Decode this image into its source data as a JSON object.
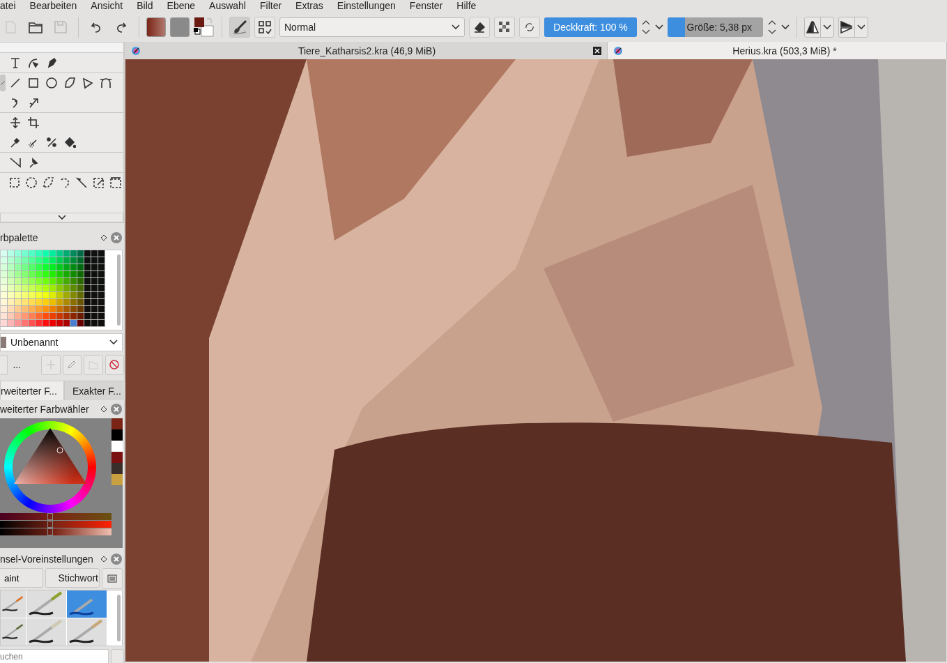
{
  "menu": [
    "atei",
    "Bearbeiten",
    "Ansicht",
    "Bild",
    "Ebene",
    "Auswahl",
    "Filter",
    "Extras",
    "Einstellungen",
    "Fenster",
    "Hilfe"
  ],
  "toolbar": {
    "blend_mode": "Normal",
    "opacity": {
      "label": "Deckkraft: 100 %",
      "level": 1
    },
    "size": {
      "label": "Größe: 5,38 px",
      "level": 0.18
    }
  },
  "documents": [
    {
      "title": "Tiere_Katharsis2.kra (46,9 MiB)",
      "selected": false
    },
    {
      "title": "Herius.kra (503,3 MiB) *",
      "selected": true
    }
  ],
  "palette_docker": {
    "title": "rbpalette",
    "palette_name": "Unbenannt",
    "more": "..."
  },
  "docker_tabs": [
    {
      "label": "rweiterter F...",
      "selected": true
    },
    {
      "label": "Exakter F...",
      "selected": false
    }
  ],
  "color_selector": {
    "title": "weiterter Farbwähler",
    "recent_colors": [
      {
        "color": "#7a2416"
      },
      {
        "color": "#000000"
      },
      {
        "color": "#ffffff"
      },
      {
        "color": "#7a1010"
      },
      {
        "color": "#3a2e2a"
      },
      {
        "color": "#c8a040"
      }
    ],
    "sliders": [
      {
        "level": 0.45
      },
      {
        "level": 0.45
      },
      {
        "level": 0.45
      }
    ]
  },
  "brush_presets": {
    "title": "nsel-Voreinstellungen",
    "tag": "aint",
    "keyword": "Stichwort",
    "presets": [
      {
        "selected": false
      },
      {
        "selected": false
      },
      {
        "selected": true
      },
      {
        "selected": false
      },
      {
        "selected": false
      },
      {
        "selected": false
      }
    ],
    "search_placeholder": "uchen"
  }
}
